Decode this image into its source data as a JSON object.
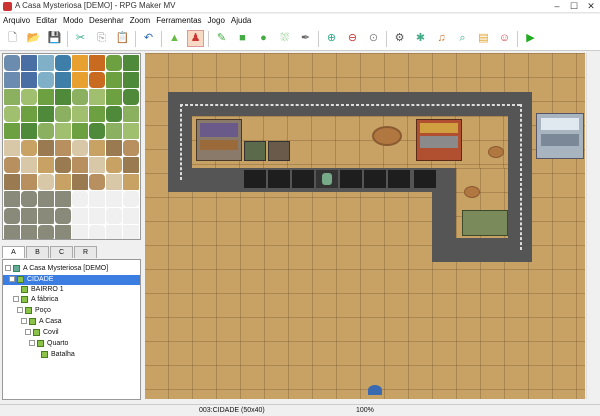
{
  "window": {
    "title": "A Casa Mysteriosa [DEMO] - RPG Maker MV",
    "min": "–",
    "max": "☐",
    "close": "✕"
  },
  "menu": [
    "Arquivo",
    "Editar",
    "Modo",
    "Desenhar",
    "Zoom",
    "Ferramentas",
    "Jogo",
    "Ajuda"
  ],
  "toolbar": {
    "icons": [
      "new-project",
      "open-project",
      "save-project",
      "cut",
      "copy",
      "paste",
      "undo",
      "map-mode",
      "event-mode",
      "pencil",
      "rectangle",
      "ellipse",
      "fill",
      "shadow-pen",
      "zoom-in",
      "zoom-out",
      "zoom-actual",
      "database",
      "plugin-manager",
      "sound-test",
      "event-searcher",
      "resource-manager",
      "character-generator",
      "playtest"
    ]
  },
  "tileset_tabs": [
    "A",
    "B",
    "C",
    "R"
  ],
  "map_tree": [
    {
      "label": "A Casa Mysteriosa [DEMO]",
      "level": 0,
      "type": "project"
    },
    {
      "label": "CIDADE",
      "level": 1,
      "selected": true
    },
    {
      "label": "BAIRRO 1",
      "level": 2
    },
    {
      "label": "A fábrica",
      "level": 2
    },
    {
      "label": "Poço",
      "level": 3
    },
    {
      "label": "A Casa",
      "level": 4
    },
    {
      "label": "Covil",
      "level": 5
    },
    {
      "label": "Quarto",
      "level": 6
    },
    {
      "label": "Batalha",
      "level": 7
    }
  ],
  "status": {
    "map": "003:CIDADE (50x40)",
    "zoom": "100%"
  },
  "colors": {
    "selection": "#3b7de0",
    "ground": "#c8a265",
    "road": "#555555"
  }
}
